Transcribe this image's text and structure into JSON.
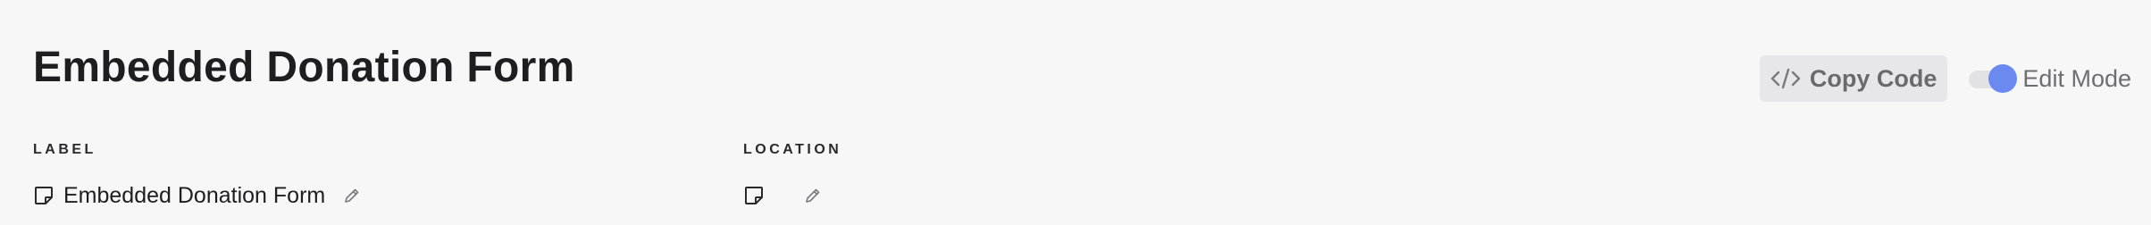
{
  "header": {
    "title": "Embedded Donation Form"
  },
  "toolbar": {
    "copy_code_label": "Copy Code",
    "edit_mode_label": "Edit Mode",
    "edit_mode_on": true,
    "accent_color": "#6a8af2"
  },
  "fields": {
    "label": {
      "heading": "LABEL",
      "value": "Embedded Donation Form",
      "icon": "note-icon",
      "edit_icon": "pencil-icon"
    },
    "location": {
      "heading": "LOCATION",
      "value": "",
      "icon": "note-icon",
      "edit_icon": "pencil-icon"
    }
  }
}
